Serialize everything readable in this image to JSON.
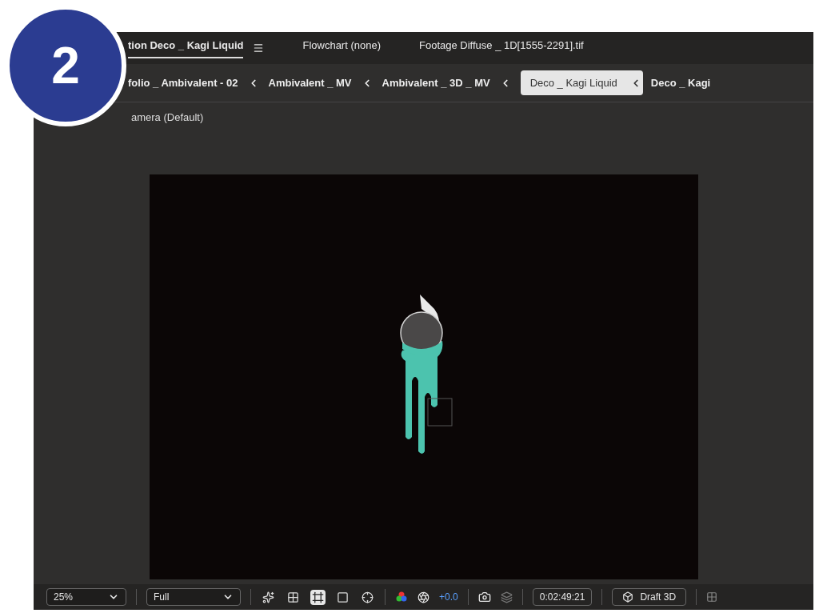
{
  "step_badge": "2",
  "panel_tabs": [
    {
      "label": "tion Deco _ Kagi Liquid",
      "selected": true
    },
    {
      "label": "Flowchart (none)",
      "selected": false
    },
    {
      "label": "Footage Diffuse _ 1D[1555-2291].tif",
      "selected": false
    }
  ],
  "breadcrumbs": [
    {
      "label": "folio _ Ambivalent - 02",
      "selected": false
    },
    {
      "label": "Ambivalent _ MV",
      "selected": false
    },
    {
      "label": "Ambivalent _ 3D _ MV",
      "selected": false
    },
    {
      "label": "Deco _ Kagi Liquid",
      "selected": true
    },
    {
      "label": "Deco _ Kagi",
      "selected": false
    }
  ],
  "camera_label": "amera (Default)",
  "toolbar": {
    "zoom": "25%",
    "resolution": "Full",
    "exposure": "+0.0",
    "timecode": "0:02:49:21",
    "renderer": "Draft 3D",
    "view_buttons": [
      {
        "selected": false
      },
      {
        "selected": false
      },
      {
        "selected": true
      },
      {
        "selected": false
      },
      {
        "selected": false
      }
    ]
  }
}
